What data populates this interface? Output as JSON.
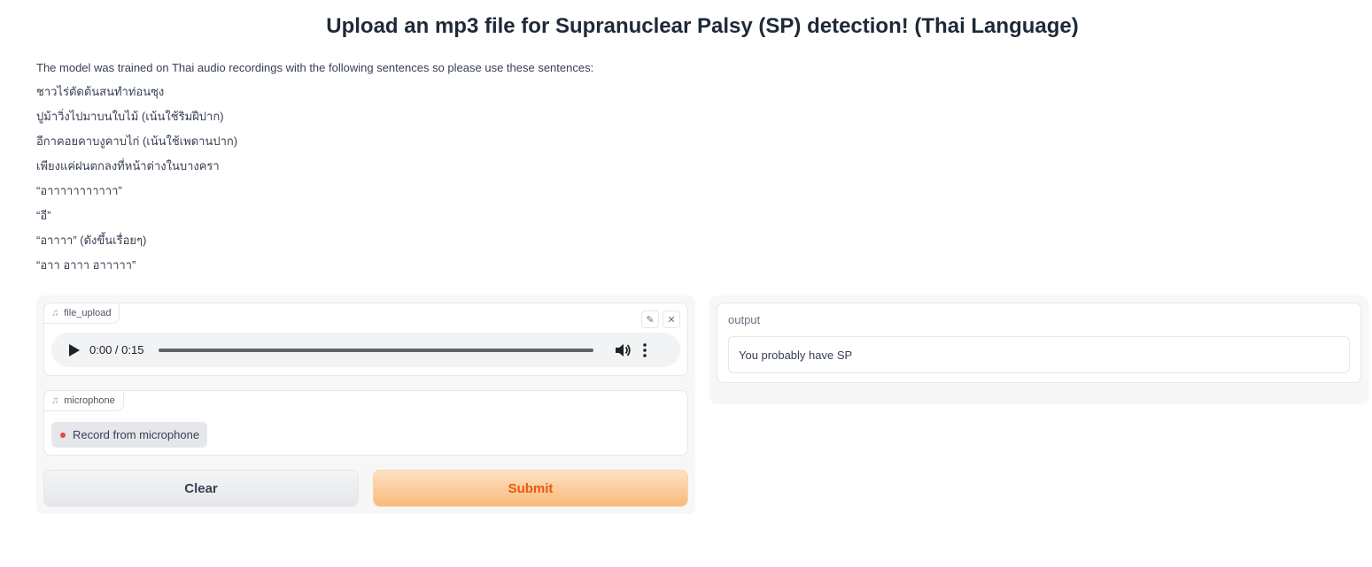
{
  "title": "Upload an mp3 file for Supranuclear Palsy (SP) detection! (Thai Language)",
  "description": {
    "intro": "The model was trained on Thai audio recordings with the following sentences so please use these sentences:",
    "sentences": [
      "ชาวไร่ตัดต้นสนทำท่อนซุง",
      "ปูม้าวิ่งไปมาบนใบไม้ (เน้นใช้ริมฝีปาก)",
      "อีกาคอยคาบงูคาบไก่ (เน้นใช้เพดานปาก)",
      "เพียงแค่ฝนตกลงที่หน้าต่างในบางครา",
      "“อาาาาาาาาาาา”",
      "“อี”",
      "“อาาาา” (ดังขึ้นเรื่อยๆ)",
      "“อาา อาาา อาาาาา”"
    ]
  },
  "inputs": {
    "file_upload": {
      "label": "file_upload",
      "icon": "music-note-icon",
      "audio_time": "0:00 / 0:15",
      "progress": 0
    },
    "microphone": {
      "label": "microphone",
      "icon": "music-note-icon",
      "record_label": "Record from microphone"
    }
  },
  "buttons": {
    "clear": "Clear",
    "submit": "Submit"
  },
  "output": {
    "label": "output",
    "value": "You probably have SP"
  },
  "colors": {
    "submit_text": "#ea580c",
    "record_dot": "#ef4444",
    "panel_bg": "#f7f7f8"
  }
}
